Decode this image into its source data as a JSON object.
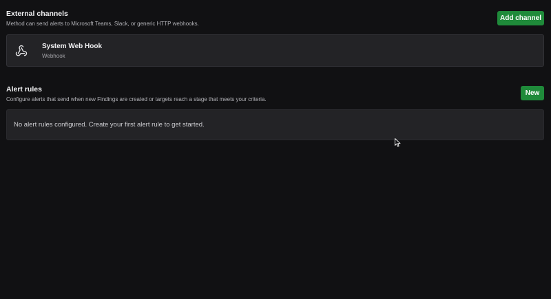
{
  "external_channels": {
    "title": "External channels",
    "description": "Method can send alerts to Microsoft Teams, Slack, or generic HTTP webhooks.",
    "add_button_label": "Add channel",
    "channels": [
      {
        "name": "System Web Hook",
        "type": "Webhook",
        "icon": "webhook-icon"
      }
    ]
  },
  "alert_rules": {
    "title": "Alert rules",
    "description": "Configure alerts that send when new Findings are created or targets reach a stage that meets your criteria.",
    "new_button_label": "New",
    "empty_message": "No alert rules configured. Create your first alert rule to get started."
  },
  "colors": {
    "background": "#111113",
    "card": "#232326",
    "accent_green": "#1f8a3a"
  }
}
